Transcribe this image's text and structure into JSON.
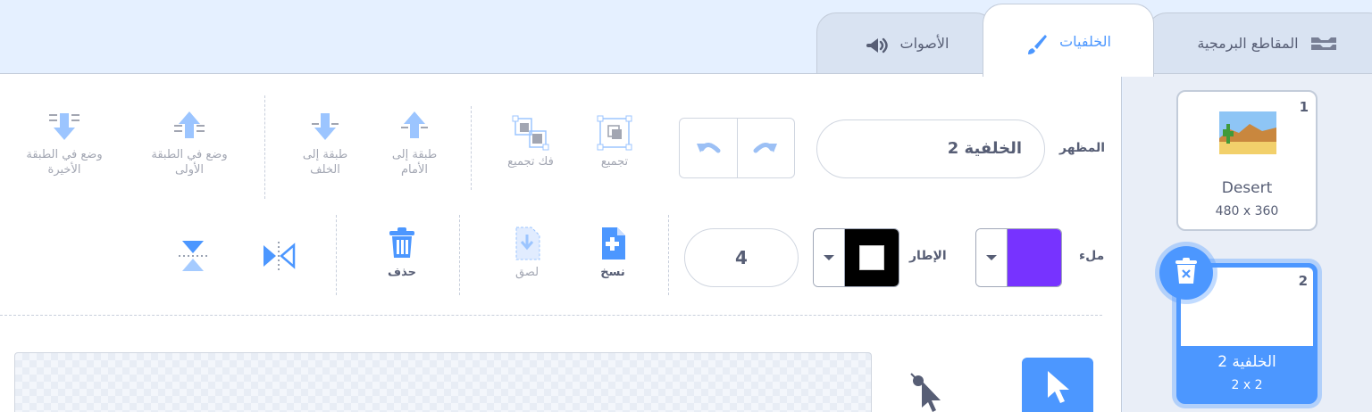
{
  "tabs": {
    "code": "المقاطع البرمجية",
    "backdrops": "الخلفيات",
    "sounds": "الأصوات"
  },
  "toolbar": {
    "costume_label": "المظهر",
    "costume_name": "الخلفية 2",
    "group": "تجميع",
    "ungroup": "فك تجميع",
    "forward": "طبقة إلى الأمام",
    "backward": "طبقة إلى الخلف",
    "front": "وضع في الطبقة الأولى",
    "back": "وضع في الطبقة الأخيرة",
    "fill_label": "ملء",
    "outline_label": "الإطار",
    "stroke_width": "4",
    "copy": "نسخ",
    "paste": "لصق",
    "delete": "حذف"
  },
  "colors": {
    "accent": "#4c97ff",
    "fill": "#7733ff",
    "outline": "#000000"
  },
  "costumes": [
    {
      "number": "1",
      "name": "Desert",
      "size": "480 x 360"
    },
    {
      "number": "2",
      "name": "الخلفية 2",
      "size": "2 x 2"
    }
  ]
}
